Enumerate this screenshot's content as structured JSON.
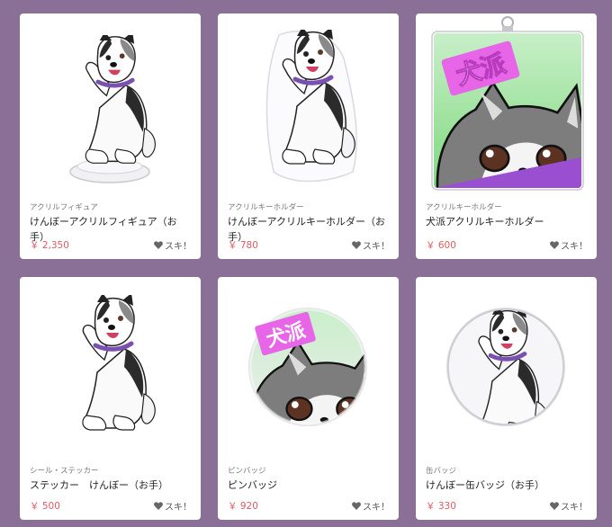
{
  "products": [
    {
      "category": "アクリルフィギュア",
      "name": "けんぼーアクリルフィギュア（お手）",
      "price": "￥ 2,350",
      "like_label": "スキ！"
    },
    {
      "category": "アクリルキーホルダー",
      "name": "けんぼーアクリルキーホルダー（お手）",
      "price": "￥ 780",
      "like_label": "スキ！"
    },
    {
      "category": "アクリルキーホルダー",
      "name": "犬派アクリルキーホルダー",
      "price": "￥ 600",
      "like_label": "スキ！"
    },
    {
      "category": "シール・ステッカー",
      "name": "ステッカー　けんぼー（お手）",
      "price": "￥ 500",
      "like_label": "スキ！"
    },
    {
      "category": "ピンバッジ",
      "name": "ピンバッジ",
      "price": "￥ 920",
      "like_label": "スキ！"
    },
    {
      "category": "缶バッジ",
      "name": "けんぼー缶バッジ（お手）",
      "price": "￥ 330",
      "like_label": "スキ！"
    }
  ],
  "artwork_text": {
    "inuha": "犬派"
  },
  "colors": {
    "background": "#8a6f96",
    "price": "#e05c64",
    "card": "#ffffff"
  }
}
